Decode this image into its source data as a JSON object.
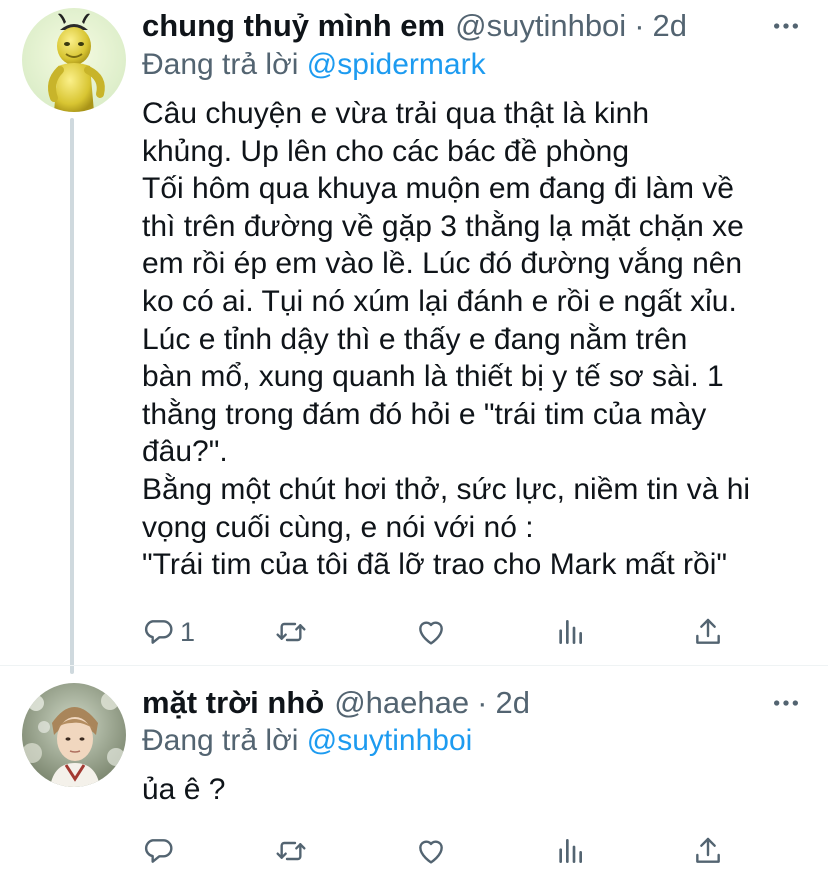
{
  "tweets": [
    {
      "display_name": "chung thuỷ mình em",
      "handle": "@suytinhboi",
      "dot": "·",
      "time": "2d",
      "reply_prefix": "Đang trả lời",
      "reply_to": "@spidermark",
      "body_lines": [
        "Câu chuyện e vừa trải qua thật là kinh",
        "khủng. Up lên cho các bác đề phòng",
        "Tối hôm qua khuya muộn em đang đi làm về",
        "thì trên đường về gặp 3 thằng lạ mặt chặn xe",
        "em rồi ép em vào lề. Lúc đó đường vắng nên",
        "ko có ai. Tụi nó xúm lại đánh e rồi e ngất xỉu.",
        "Lúc e tỉnh dậy thì e thấy e đang nằm trên",
        "bàn mổ, xung quanh là thiết bị y tế sơ sài. 1",
        "thằng trong đám đó hỏi e \"trái tim của mày",
        "đâu?\".",
        "Bằng một chút hơi thở, sức lực, niềm tin và hi",
        "vọng cuối cùng, e nói với nó :",
        "\"Trái tim của tôi đã lỡ trao cho Mark mất rồi\""
      ],
      "reply_count": "1",
      "icons": [
        "reply-icon",
        "retweet-icon",
        "like-icon",
        "stats-icon",
        "share-icon",
        "more-icon"
      ]
    },
    {
      "display_name": "mặt trời nhỏ",
      "handle": "@haehae",
      "dot": "·",
      "time": "2d",
      "reply_prefix": "Đang trả lời",
      "reply_to": "@suytinhboi",
      "body_lines": [
        "ủa ê ?"
      ],
      "icons": [
        "reply-icon",
        "retweet-icon",
        "like-icon",
        "stats-icon",
        "share-icon",
        "more-icon"
      ]
    }
  ],
  "colors": {
    "text": "#0f1419",
    "secondary": "#536471",
    "link": "#1d9bf0",
    "thread_line": "#cfd9de"
  }
}
